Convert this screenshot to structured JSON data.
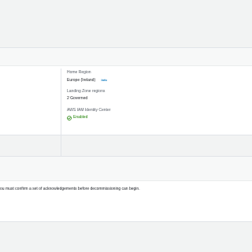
{
  "details": {
    "home_region_label": "Home Region",
    "home_region_value": "Europe (Ireland)",
    "info_link": "Info",
    "landing_zone_label": "Landing Zone regions",
    "landing_zone_value": "2 Governed",
    "identity_center_label": "AWS IAM Identity Center",
    "identity_center_status": "Enabled",
    "status_icon": "check-circle-icon",
    "status_color": "#1d8102"
  },
  "decommission": {
    "note": "ou must confirm a set of acknowledgements before decommissioning can begin."
  }
}
